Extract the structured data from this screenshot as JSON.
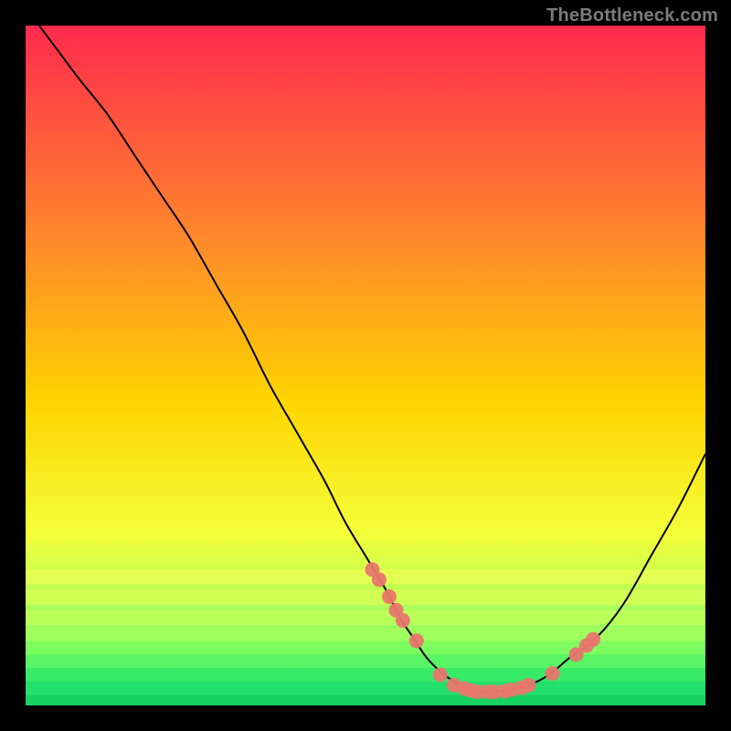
{
  "watermark": "TheBottleneck.com",
  "colors": {
    "black": "#000000",
    "curve": "#000000",
    "dot": "#e9766e",
    "grad_top": "#ff2a4d",
    "grad_mid_upper": "#ff8a2a",
    "grad_mid": "#ffd400",
    "grad_mid_lower": "#f4ff3a",
    "grad_green_soft": "#8dff6a",
    "grad_green": "#23e06a"
  },
  "chart_data": {
    "type": "line",
    "title": "",
    "xlabel": "",
    "ylabel": "",
    "xlim": [
      0,
      100
    ],
    "ylim": [
      0,
      100
    ],
    "curve": {
      "x": [
        2,
        5,
        8,
        12,
        16,
        20,
        24,
        28,
        32,
        36,
        40,
        44,
        47,
        50,
        53,
        55,
        57,
        59,
        61,
        63,
        65,
        67,
        69,
        71,
        74,
        77,
        80,
        84,
        88,
        92,
        96,
        100
      ],
      "y": [
        100,
        96,
        92,
        87,
        81,
        75,
        69,
        62,
        55,
        47,
        40,
        33,
        27,
        22,
        17,
        13,
        10,
        7,
        5,
        3.5,
        2.5,
        2,
        2,
        2.3,
        3,
        4.5,
        7,
        10,
        15,
        22,
        29,
        37
      ]
    },
    "dots": [
      {
        "x": 51.0,
        "y": 20.0
      },
      {
        "x": 52.0,
        "y": 18.5
      },
      {
        "x": 53.5,
        "y": 16.0
      },
      {
        "x": 54.5,
        "y": 14.0
      },
      {
        "x": 55.5,
        "y": 12.5
      },
      {
        "x": 57.5,
        "y": 9.5
      },
      {
        "x": 61.0,
        "y": 4.5
      },
      {
        "x": 63.0,
        "y": 3.0
      },
      {
        "x": 64.5,
        "y": 2.5
      },
      {
        "x": 65.5,
        "y": 2.2
      },
      {
        "x": 66.5,
        "y": 2.0
      },
      {
        "x": 68.0,
        "y": 2.0
      },
      {
        "x": 69.0,
        "y": 2.0
      },
      {
        "x": 70.5,
        "y": 2.1
      },
      {
        "x": 71.5,
        "y": 2.3
      },
      {
        "x": 73.0,
        "y": 2.6
      },
      {
        "x": 74.0,
        "y": 3.0
      },
      {
        "x": 77.5,
        "y": 4.7
      },
      {
        "x": 81.0,
        "y": 7.5
      },
      {
        "x": 82.5,
        "y": 8.8
      },
      {
        "x": 83.5,
        "y": 9.7
      }
    ]
  }
}
